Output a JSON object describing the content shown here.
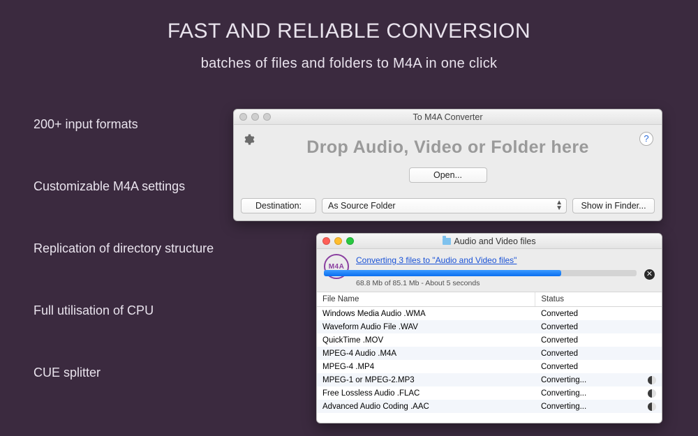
{
  "promo": {
    "headline": "FAST AND RELIABLE CONVERSION",
    "subhead": "batches of files and folders to M4A in one click",
    "features": [
      "200+ input formats",
      "Customizable M4A settings",
      "Replication of directory structure",
      "Full utilisation of CPU",
      "CUE splitter"
    ]
  },
  "win1": {
    "title": "To M4A Converter",
    "drop_message": "Drop Audio, Video or Folder here",
    "open_label": "Open...",
    "destination_label": "Destination:",
    "destination_value": "As Source Folder",
    "show_finder_label": "Show in Finder...",
    "help_icon": "?"
  },
  "win2": {
    "title": "Audio and Video files",
    "badge": "M4A",
    "converting_link": "Converting 3 files to \"Audio and Video files\"",
    "progress_stat": "68.8 Mb of 85.1 Mb - About 5 seconds",
    "col_filename": "File Name",
    "col_status": "Status",
    "rows": [
      {
        "name": "Windows Media Audio .WMA",
        "status": "Converted",
        "busy": false
      },
      {
        "name": "Waveform Audio File .WAV",
        "status": "Converted",
        "busy": false
      },
      {
        "name": "QuickTime .MOV",
        "status": "Converted",
        "busy": false
      },
      {
        "name": "MPEG-4 Audio .M4A",
        "status": "Converted",
        "busy": false
      },
      {
        "name": "MPEG-4 .MP4",
        "status": "Converted",
        "busy": false
      },
      {
        "name": "MPEG-1 or MPEG-2.MP3",
        "status": "Converting...",
        "busy": true
      },
      {
        "name": "Free Lossless Audio .FLAC",
        "status": "Converting...",
        "busy": true
      },
      {
        "name": "Advanced Audio Coding .AAC",
        "status": "Converting...",
        "busy": true
      }
    ]
  }
}
